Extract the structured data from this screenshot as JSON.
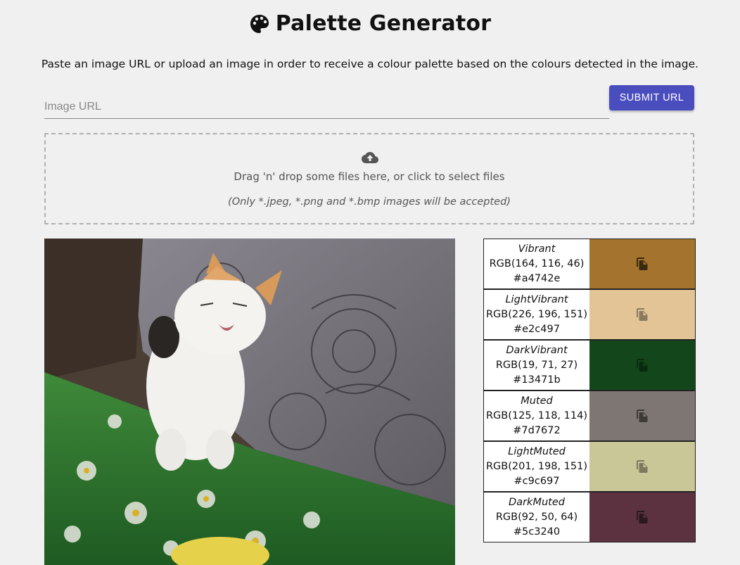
{
  "header": {
    "title": "Palette Generator",
    "icon": "palette-icon"
  },
  "subtitle": "Paste an image URL or upload an image in order to receive a colour palette based on the colours detected in the image.",
  "url_form": {
    "placeholder": "Image URL",
    "value": "",
    "submit_label": "SUBMIT URL"
  },
  "dropzone": {
    "icon": "cloud-upload-icon",
    "text": "Drag 'n' drop some files here, or click to select files",
    "note": "(Only *.jpeg, *.png and *.bmp images will be accepted)"
  },
  "image": {
    "description": "uploaded-cat-photo"
  },
  "palette": [
    {
      "name": "Vibrant",
      "rgb": "RGB(164, 116, 46)",
      "hex": "#a4742e",
      "icon_color": "#3a2a12"
    },
    {
      "name": "LightVibrant",
      "rgb": "RGB(226, 196, 151)",
      "hex": "#e2c497",
      "icon_color": "#8c7a5e"
    },
    {
      "name": "DarkVibrant",
      "rgb": "RGB(19, 71, 27)",
      "hex": "#13471b",
      "icon_color": "#0a2a10"
    },
    {
      "name": "Muted",
      "rgb": "RGB(125, 118, 114)",
      "hex": "#7d7672",
      "icon_color": "#3e3a38"
    },
    {
      "name": "LightMuted",
      "rgb": "RGB(201, 198, 151)",
      "hex": "#c9c697",
      "icon_color": "#7c7a5c"
    },
    {
      "name": "DarkMuted",
      "rgb": "RGB(92, 50, 64)",
      "hex": "#5c3240",
      "icon_color": "#2a1820"
    }
  ]
}
